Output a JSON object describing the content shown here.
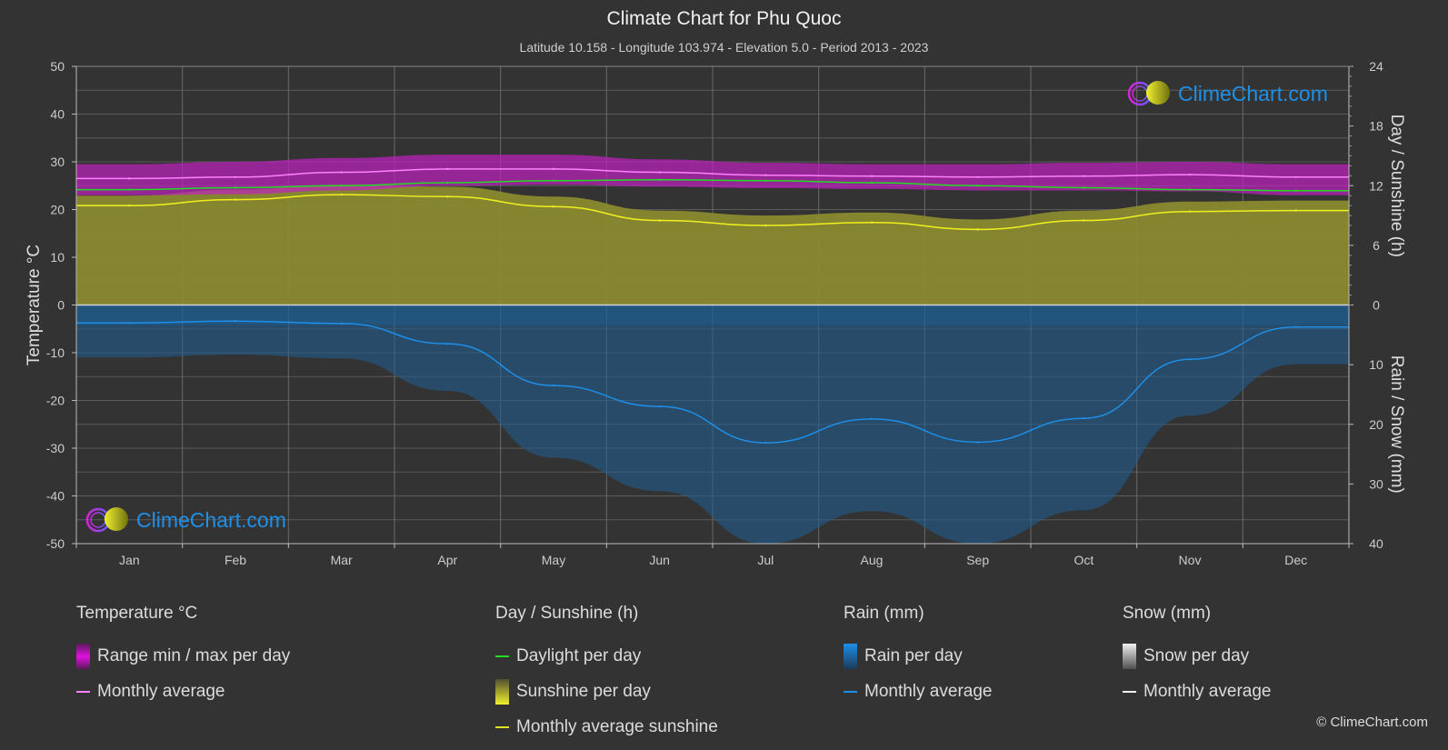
{
  "header": {
    "title": "Climate Chart for Phu Quoc",
    "subtitle": "Latitude 10.158 - Longitude 103.974 - Elevation 5.0 - Period 2013 - 2023"
  },
  "logo": {
    "text": "ClimeChart.com"
  },
  "copyright": "© ClimeChart.com",
  "colors": {
    "background": "#333333",
    "temp_range": "#c020c0",
    "temp_avg": "#ff80ff",
    "daylight": "#22dd22",
    "sunshine_fill": "#8a8a30",
    "sunshine_avg": "#f0f020",
    "rain_fill": "#1d5f94",
    "rain_avg": "#1e8fe8",
    "grid": "#5a5a5a"
  },
  "legend": {
    "temperature": {
      "heading": "Temperature °C",
      "items": [
        "Range min / max per day",
        "Monthly average"
      ]
    },
    "sunshine": {
      "heading": "Day / Sunshine (h)",
      "items": [
        "Daylight per day",
        "Sunshine per day",
        "Monthly average sunshine"
      ]
    },
    "rain": {
      "heading": "Rain (mm)",
      "items": [
        "Rain per day",
        "Monthly average"
      ]
    },
    "snow": {
      "heading": "Snow (mm)",
      "items": [
        "Snow per day",
        "Monthly average"
      ]
    }
  },
  "chart_data": {
    "type": "line",
    "title": "Climate Chart for Phu Quoc",
    "categories": [
      "Jan",
      "Feb",
      "Mar",
      "Apr",
      "May",
      "Jun",
      "Jul",
      "Aug",
      "Sep",
      "Oct",
      "Nov",
      "Dec"
    ],
    "y_left": {
      "label": "Temperature °C",
      "range": [
        -50,
        50
      ],
      "ticks": [
        "50",
        "40",
        "30",
        "20",
        "10",
        "0",
        "-10",
        "-20",
        "-30",
        "-40",
        "-50"
      ]
    },
    "y_right_top": {
      "label": "Day / Sunshine (h)",
      "range": [
        0,
        24
      ],
      "ticks": [
        "24",
        "18",
        "12",
        "6",
        "0"
      ]
    },
    "y_right_bottom": {
      "label": "Rain / Snow (mm)",
      "range": [
        0,
        40
      ],
      "ticks": [
        "0",
        "10",
        "20",
        "30",
        "40"
      ]
    },
    "grid": true,
    "series": [
      {
        "name": "Temperature monthly average (°C)",
        "axis": "temp",
        "values": [
          26.5,
          26.8,
          27.8,
          28.5,
          28.5,
          27.8,
          27.2,
          27.0,
          26.8,
          27.0,
          27.3,
          26.8
        ]
      },
      {
        "name": "Temperature max per day (°C)",
        "axis": "temp",
        "values": [
          29.5,
          30.0,
          30.8,
          31.5,
          31.5,
          30.5,
          29.8,
          29.5,
          29.5,
          29.8,
          30.0,
          29.5
        ]
      },
      {
        "name": "Temperature min per day (°C)",
        "axis": "temp",
        "values": [
          23.0,
          23.2,
          24.0,
          25.0,
          25.2,
          24.8,
          24.5,
          24.3,
          24.0,
          24.0,
          23.8,
          23.0
        ]
      },
      {
        "name": "Daylight per day (h)",
        "axis": "hours",
        "values": [
          11.6,
          11.8,
          12.0,
          12.3,
          12.5,
          12.6,
          12.5,
          12.3,
          12.0,
          11.8,
          11.6,
          11.5
        ]
      },
      {
        "name": "Monthly average sunshine (h)",
        "axis": "hours",
        "values": [
          10.0,
          10.6,
          11.1,
          10.9,
          9.9,
          8.5,
          8.0,
          8.3,
          7.6,
          8.5,
          9.4,
          9.5
        ]
      },
      {
        "name": "Rain monthly average (mm)",
        "axis": "rain",
        "values": [
          3.0,
          2.7,
          3.1,
          6.5,
          13.5,
          17.0,
          23.1,
          19.1,
          23.0,
          19.0,
          9.1,
          3.7
        ]
      }
    ]
  }
}
